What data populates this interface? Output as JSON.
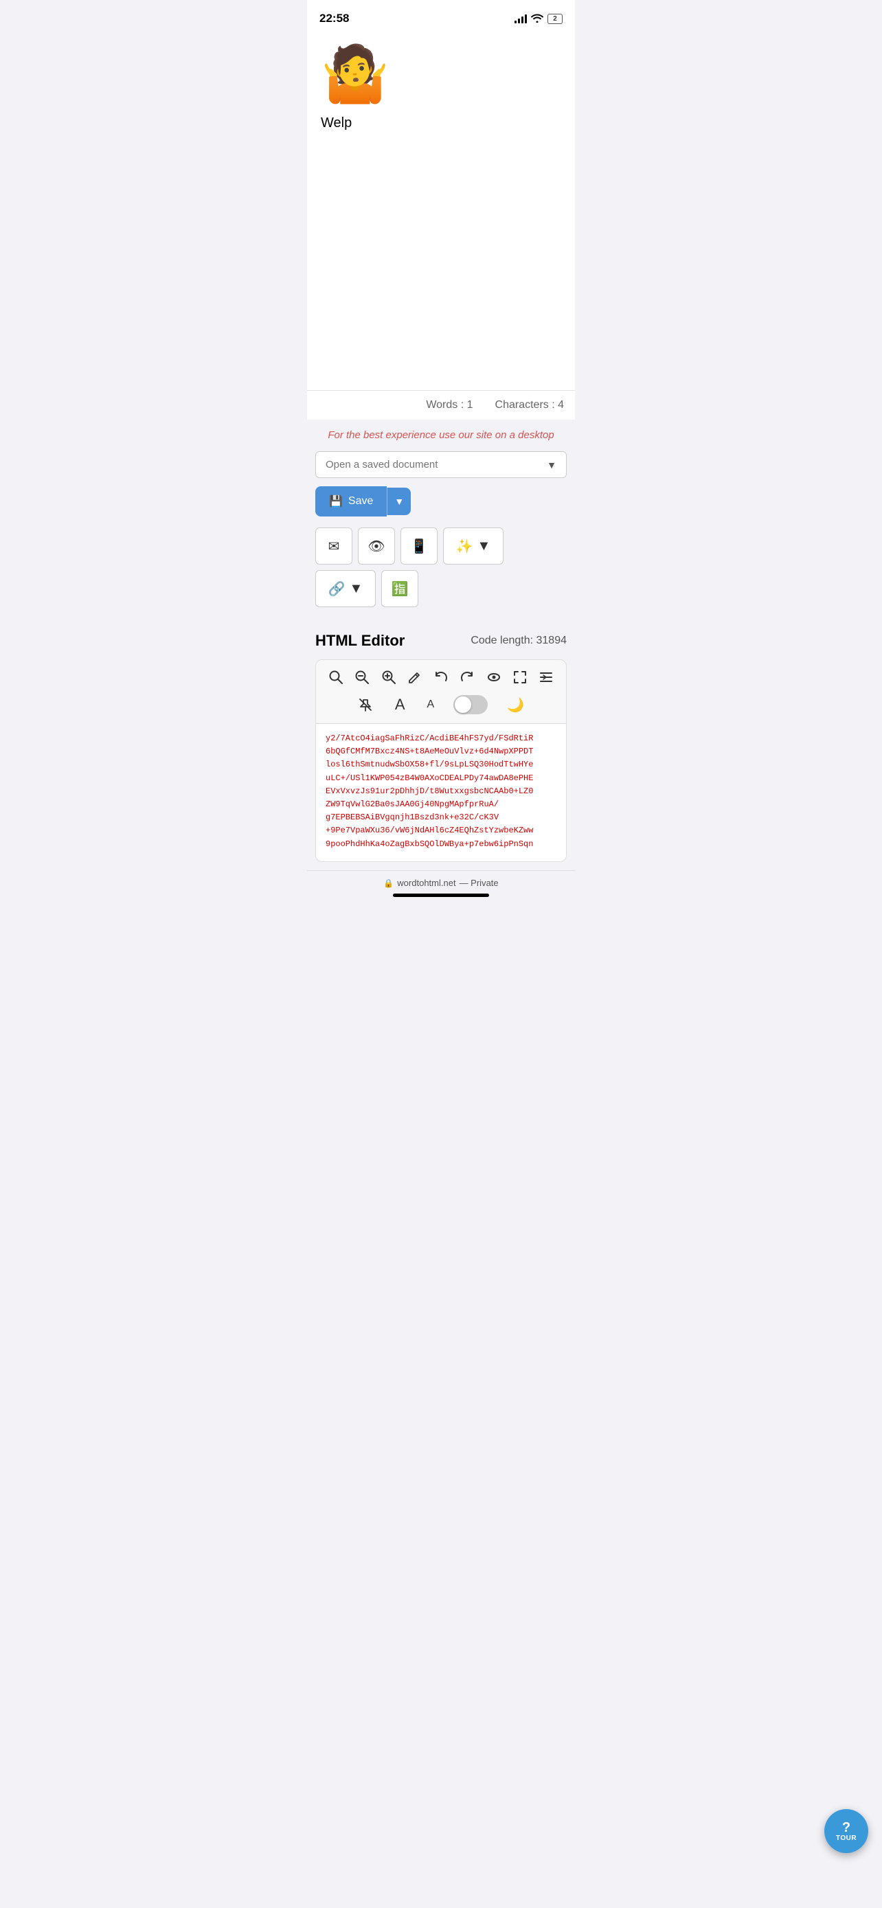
{
  "statusBar": {
    "time": "22:58",
    "battery": "2"
  },
  "document": {
    "emoji": "🤷",
    "text": "Welp",
    "wordCount": "Words : 1",
    "charCount": "Characters : 4"
  },
  "notice": {
    "text": "For the best experience use our site on a desktop"
  },
  "toolbar": {
    "openDocPlaceholder": "Open a saved document",
    "saveLabel": "Save",
    "openDocChevron": "▼"
  },
  "htmlEditor": {
    "title": "HTML Editor",
    "codeLengthLabel": "Code length: 31894"
  },
  "codeContent": {
    "line1": "y2/7AtcO4iagSaFhRizC/AcdiBE4hFS7yd/FSdRtiR",
    "line2": "6bQGfCMfM7Bxcz4NS+t8AeMeOuVlvz+6d4NwpXPPDT",
    "line3": "losl6thSmtnudwSbOX58+fl/9sLpLSQ30HodTtwHYe",
    "line4": "uLC+/USl1KWP054zB4W0AXoCDEALPDy74awDA8ePHE",
    "line5": "EVxVxvzJs91ur2pDhhjD/t8WutxxgsbcNCAAb0+LZ0",
    "line6": "ZW9TqVwlG2Ba0sJAA0Gj40NpgMApfprRuA/",
    "line7": "g7EPBEBSAiBVgqnjh1Bszd3nk+e32C/cK3V",
    "line8": "+9Pe7VpaWXu36/vW6jNdAHl6cZ4EQhZstYzwbeKZww",
    "line9": "9pooPhdHhKa4oZagBxbSQOlDWBya+p7ebw6ipPnSqn"
  },
  "tourButton": {
    "question": "?",
    "label": "TOUR"
  },
  "bottomBar": {
    "lockIcon": "🔒",
    "url": "wordtohtml.net",
    "privacy": "— Private"
  }
}
